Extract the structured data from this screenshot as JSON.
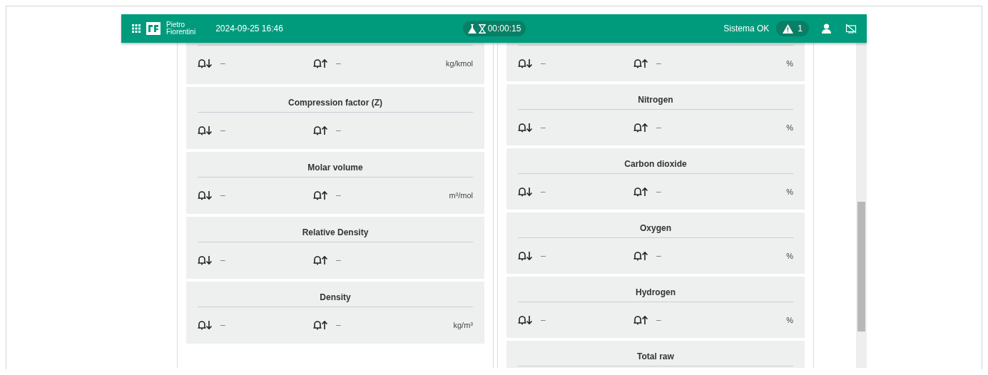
{
  "header": {
    "brand": [
      "Pietro",
      "Fiorentini"
    ],
    "datetime": "2024-09-25 16:46",
    "timer": "00:00:15",
    "status": "Sistema OK",
    "alarm_count": "1"
  },
  "columns": [
    {
      "cards": [
        {
          "kind": "top-cut",
          "low": "–",
          "high": "–",
          "unit": "kg/kmol"
        },
        {
          "kind": "full",
          "title": "Compression factor (Z)",
          "low": "–",
          "high": "–"
        },
        {
          "kind": "full",
          "title": "Molar volume",
          "low": "–",
          "high": "–",
          "unit": "m³/mol"
        },
        {
          "kind": "full",
          "title": "Relative Density",
          "low": "–",
          "high": "–"
        },
        {
          "kind": "full",
          "title": "Density",
          "low": "–",
          "high": "–",
          "unit": "kg/m³"
        }
      ]
    },
    {
      "cards": [
        {
          "kind": "top-cut",
          "low": "–",
          "high": "–",
          "unit": "%"
        },
        {
          "kind": "full",
          "title": "Nitrogen",
          "low": "–",
          "high": "–",
          "unit": "%"
        },
        {
          "kind": "full",
          "title": "Carbon dioxide",
          "low": "–",
          "high": "–",
          "unit": "%"
        },
        {
          "kind": "full",
          "title": "Oxygen",
          "low": "–",
          "high": "–",
          "unit": "%"
        },
        {
          "kind": "full",
          "title": "Hydrogen",
          "low": "–",
          "high": "–",
          "unit": "%"
        },
        {
          "kind": "bottom-cut",
          "title": "Total raw"
        }
      ]
    }
  ]
}
